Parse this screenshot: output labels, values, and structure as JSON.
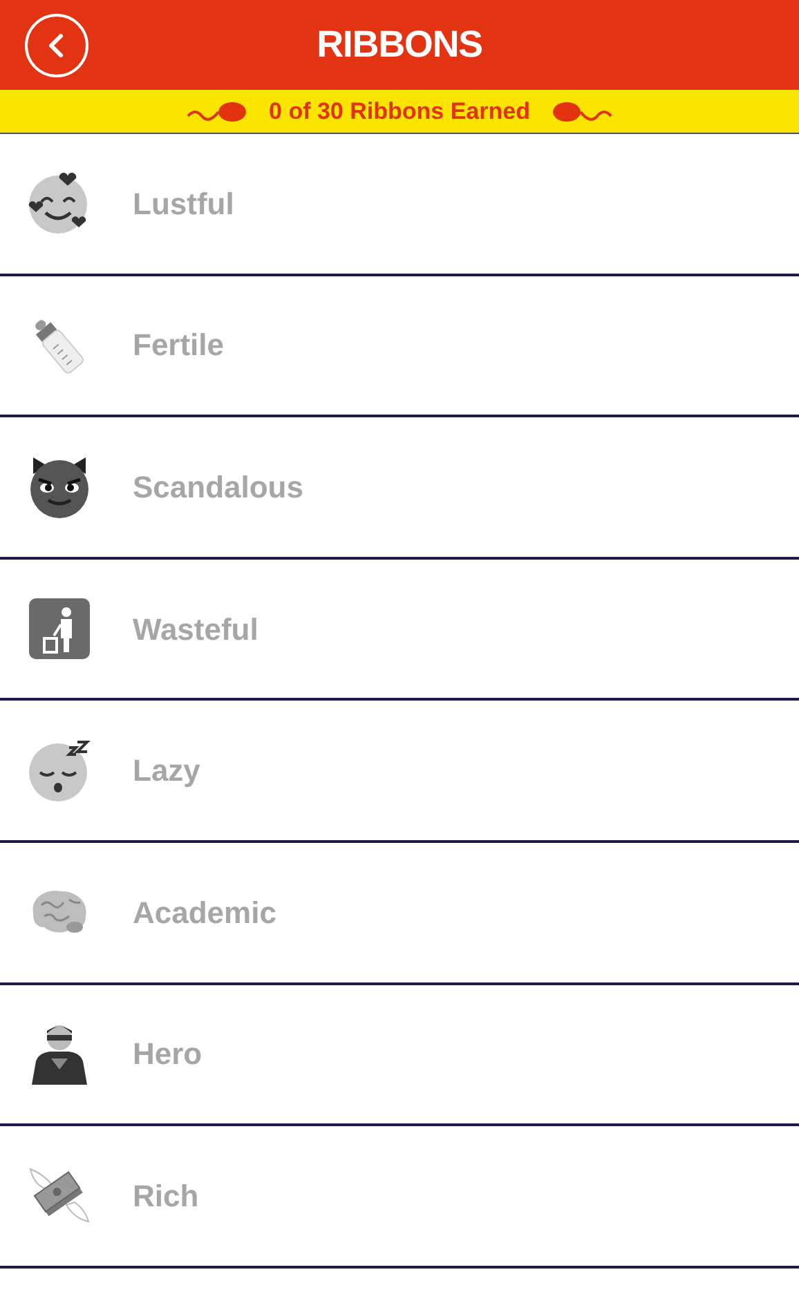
{
  "header": {
    "title": "RIBBONS"
  },
  "banner": {
    "text": "0 of 30 Ribbons Earned"
  },
  "ribbons": [
    {
      "name": "Lustful",
      "earned": false
    },
    {
      "name": "Fertile",
      "earned": false
    },
    {
      "name": "Scandalous",
      "earned": false
    },
    {
      "name": "Wasteful",
      "earned": false
    },
    {
      "name": "Lazy",
      "earned": false
    },
    {
      "name": "Academic",
      "earned": false
    },
    {
      "name": "Hero",
      "earned": false
    },
    {
      "name": "Rich",
      "earned": false
    }
  ]
}
